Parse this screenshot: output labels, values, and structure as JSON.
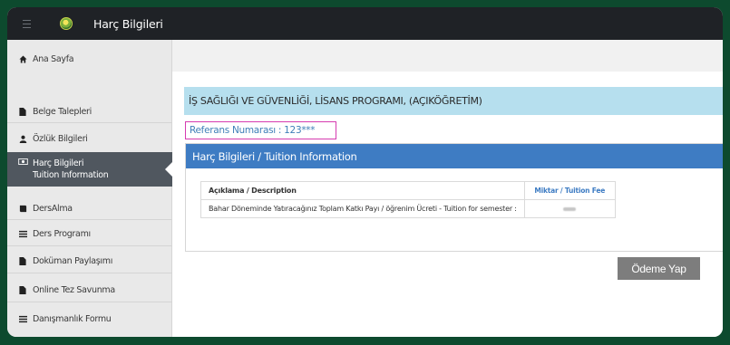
{
  "header": {
    "title": "Harç Bilgileri"
  },
  "sidebar": {
    "items": [
      {
        "label": "Ana Sayfa",
        "icon": "home-icon"
      },
      {
        "label": "Belge Talepleri",
        "icon": "document-icon"
      },
      {
        "label": "Özlük Bilgileri",
        "icon": "user-icon"
      },
      {
        "label": "Harç Bilgileri",
        "sublabel": "Tuition Information",
        "icon": "money-icon",
        "active": true
      },
      {
        "label": "DersAlma",
        "icon": "book-icon"
      },
      {
        "label": "Ders Programı",
        "icon": "list-icon"
      },
      {
        "label": "Doküman Paylaşımı",
        "icon": "document-icon"
      },
      {
        "label": "Online Tez Savunma",
        "icon": "document-icon"
      },
      {
        "label": "Danışmanlık Formu",
        "icon": "list-icon"
      }
    ]
  },
  "main": {
    "program": "İŞ SAĞLIĞI VE GÜVENLİĞİ, LİSANS PROGRAMI, (AÇIKÖĞRETİM)",
    "reference": "Referans Numarası : 123***",
    "panel_title": "Harç Bilgileri / Tuition Information",
    "table": {
      "headers": [
        "Açıklama / Description",
        "Miktar / Tuition Fee"
      ],
      "rows": [
        {
          "description": "Bahar Döneminde Yatıracağınız Toplam Katkı Payı / öğrenim Ücreti - Tuition for semester :",
          "fee_redacted": true
        }
      ]
    },
    "pay_button": "Ödeme Yap"
  },
  "colors": {
    "outer_background": "#0d4a2e",
    "topbar": "#1f2226",
    "sidebar_active": "#50575f",
    "program_bar": "#b6dfee",
    "panel_header": "#3e7cc3",
    "reference_highlight": "#d63bb0",
    "pay_button": "#7d7d7d"
  }
}
